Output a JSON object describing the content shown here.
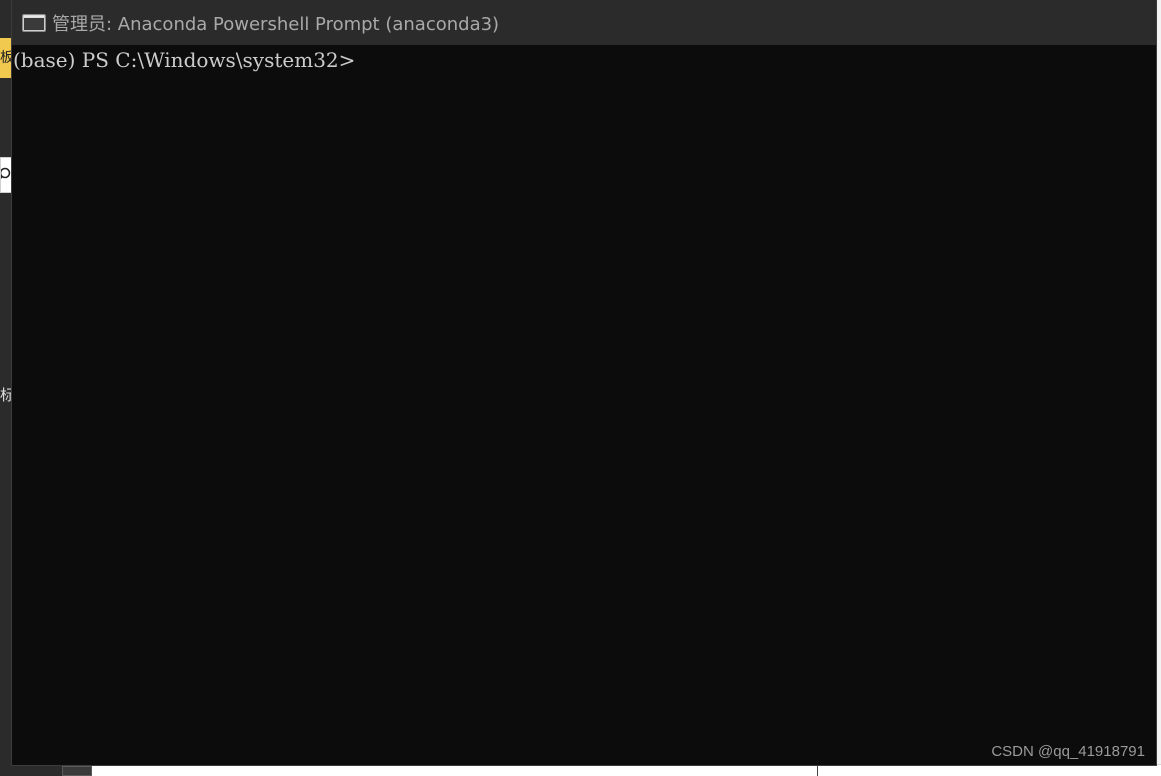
{
  "window": {
    "title": "管理员: Anaconda Powershell Prompt (anaconda3)",
    "icon": "console-icon"
  },
  "console": {
    "prompt": "(base) PS C:\\Windows\\system32>"
  },
  "background": {
    "left_tab_char": "板",
    "left_text_char": "标"
  },
  "watermark": {
    "text": "CSDN @qq_41918791"
  },
  "colors": {
    "console_bg": "#0c0c0c",
    "titlebar_bg": "#2b2b2b",
    "console_text": "#cccccc",
    "title_text": "#a9a9a9",
    "background_tab": "#f0c94e"
  }
}
